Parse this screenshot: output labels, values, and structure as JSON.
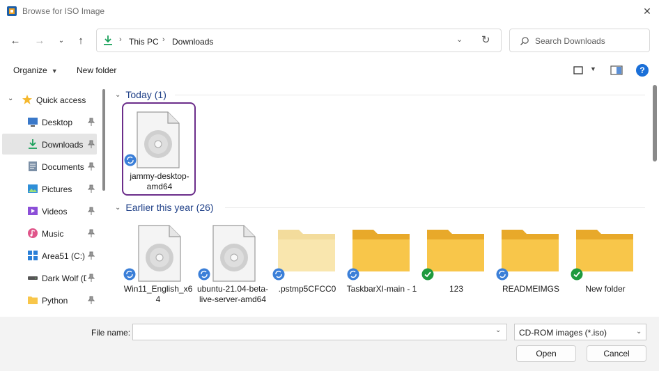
{
  "window": {
    "title": "Browse for ISO Image"
  },
  "nav": {
    "breadcrumbs": [
      "This PC",
      "Downloads"
    ],
    "search_placeholder": "Search Downloads"
  },
  "toolbar": {
    "organize_label": "Organize",
    "new_folder_label": "New folder",
    "help_label": "?"
  },
  "sidebar": {
    "quick_access": "Quick access",
    "items": [
      {
        "label": "Desktop",
        "icon": "desktop-icon"
      },
      {
        "label": "Downloads",
        "icon": "download-icon"
      },
      {
        "label": "Documents",
        "icon": "documents-icon"
      },
      {
        "label": "Pictures",
        "icon": "pictures-icon"
      },
      {
        "label": "Videos",
        "icon": "videos-icon"
      },
      {
        "label": "Music",
        "icon": "music-icon"
      },
      {
        "label": "Area51 (C:)",
        "icon": "drive-icon"
      },
      {
        "label": "Dark Wolf (D",
        "icon": "drive-icon"
      },
      {
        "label": "Python",
        "icon": "folder-icon"
      }
    ]
  },
  "groups": [
    {
      "title": "Today",
      "count": "(1)",
      "items": [
        {
          "name": "jammy-desktop-amd64",
          "type": "iso",
          "status": "sync"
        }
      ]
    },
    {
      "title": "Earlier this year",
      "count": "(26)",
      "items": [
        {
          "name": "Win11_English_x64",
          "type": "iso",
          "status": "sync"
        },
        {
          "name": "ubuntu-21.04-beta-live-server-amd64",
          "type": "iso",
          "status": "sync"
        },
        {
          "name": ".pstmp5CFCC0",
          "type": "folder-light",
          "status": "sync"
        },
        {
          "name": "TaskbarXI-main - 1",
          "type": "folder",
          "status": "sync"
        },
        {
          "name": "123",
          "type": "folder",
          "status": "ok"
        },
        {
          "name": "READMEIMGS",
          "type": "folder",
          "status": "sync"
        },
        {
          "name": "New folder",
          "type": "folder",
          "status": "ok"
        }
      ]
    }
  ],
  "bottom": {
    "file_name_label": "File name:",
    "file_name_value": "",
    "filter_value": "CD-ROM images (*.iso)",
    "open_label": "Open",
    "cancel_label": "Cancel"
  },
  "colors": {
    "accent": "#1a6fd8",
    "selection_border": "#6b2d8a",
    "group_title": "#1e3f87",
    "folder": "#f8c64a"
  }
}
